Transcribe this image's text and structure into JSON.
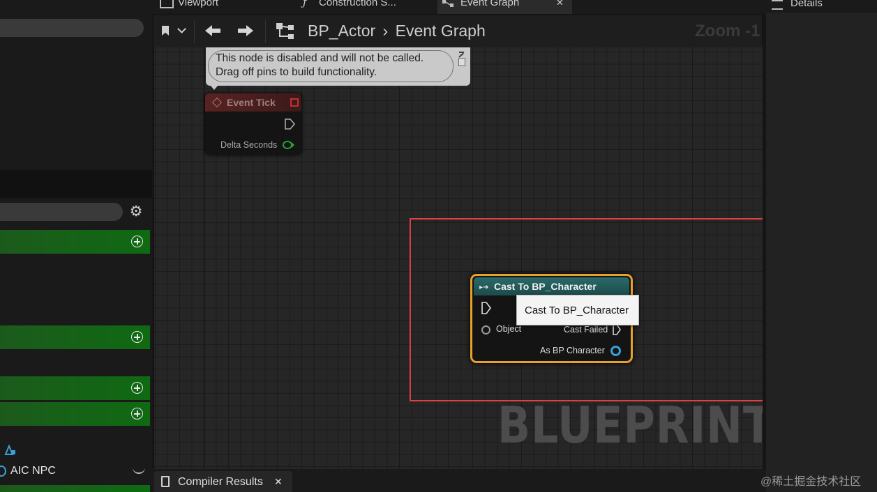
{
  "tabs": [
    {
      "label": "Viewport",
      "icon": "viewport-icon"
    },
    {
      "label": "Construction S...",
      "icon": "function-icon"
    },
    {
      "label": "Event Graph",
      "icon": "graph-icon",
      "close": "✕"
    }
  ],
  "details": {
    "title": "Details"
  },
  "toolbar": {
    "breadcrumb_root": "BP_Actor",
    "breadcrumb_separator": "›",
    "breadcrumb_current": "Event Graph",
    "zoom_label": "Zoom -1"
  },
  "comment_bubble": {
    "line1": "This node is disabled and will not be called.",
    "line2": "Drag off pins to build functionality."
  },
  "event_tick_node": {
    "title": "Event Tick",
    "pin_delta": "Delta Seconds"
  },
  "cast_node": {
    "title": "Cast To BP_Character",
    "pin_object": "Object",
    "pin_cast_failed": "Cast Failed",
    "pin_as": "As BP Character",
    "tooltip": "Cast To BP_Character"
  },
  "watermark": {
    "text": "BLUEPRINT"
  },
  "left_panel": {
    "list_item_label": "AIC NPC"
  },
  "bottom": {
    "compiler_tab": "Compiler Results",
    "close": "✕"
  },
  "corner_watermark": "@稀土掘金技术社区",
  "colors": {
    "section_green": "#0f6a12",
    "cast_node_header": "#1d5a5a",
    "cast_node_border": "#e8a12a",
    "highlight_box": "#e04040",
    "object_pin": "#3aa0d8"
  }
}
